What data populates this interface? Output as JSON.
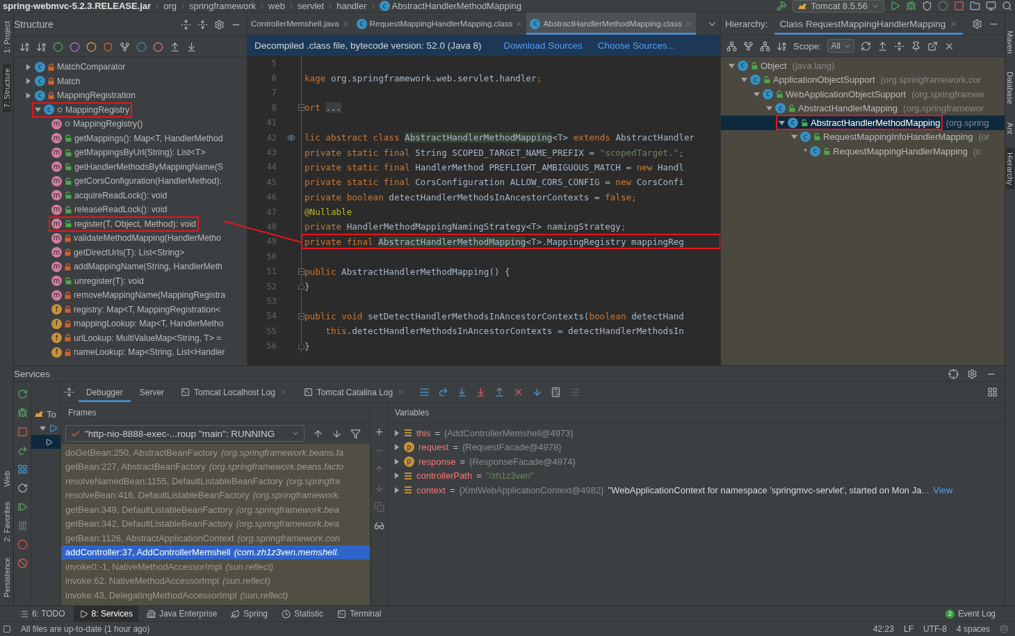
{
  "breadcrumbs": [
    {
      "label": "spring-webmvc-5.2.3.RELEASE.jar",
      "kind": "jar"
    },
    {
      "label": "org",
      "kind": "package"
    },
    {
      "label": "springframework",
      "kind": "package"
    },
    {
      "label": "web",
      "kind": "package"
    },
    {
      "label": "servlet",
      "kind": "package"
    },
    {
      "label": "handler",
      "kind": "package"
    },
    {
      "label": "AbstractHandlerMethodMapping",
      "kind": "class",
      "symbol": "c"
    }
  ],
  "run_config": {
    "label": "Tomcat 8.5.56"
  },
  "left_strip": [
    {
      "label": "1: Project",
      "selected": false
    },
    {
      "label": "7: Structure",
      "selected": true
    }
  ],
  "left_strip_bottom": [
    {
      "label": "Web",
      "selected": false
    },
    {
      "label": "2: Favorites",
      "selected": false
    },
    {
      "label": "Persistence",
      "selected": false
    }
  ],
  "right_strip": [
    {
      "label": "Maven",
      "selected": false
    },
    {
      "label": "Database",
      "selected": false
    },
    {
      "label": "Ant",
      "selected": false
    },
    {
      "label": "Hierarchy",
      "selected": true
    }
  ],
  "annotation_connector": true,
  "structure": {
    "title": "Structure",
    "items": [
      {
        "label": "MatchComparator",
        "kind": "class",
        "symbol": "c",
        "private": true,
        "public": false,
        "expanded": false,
        "annotated": false
      },
      {
        "label": "Match",
        "kind": "class",
        "symbol": "c",
        "private": true,
        "public": false,
        "expanded": false,
        "annotated": false
      },
      {
        "label": "MappingRegistration",
        "kind": "class",
        "symbol": "c",
        "private": true,
        "public": false,
        "expanded": false,
        "annotated": false
      },
      {
        "label": "MappingRegistry",
        "kind": "class",
        "symbol": "c",
        "private": false,
        "public": false,
        "expanded": true,
        "annotated": true,
        "children": [
          {
            "label": "MappingRegistry()",
            "kind": "method",
            "symbol": "m",
            "private": false,
            "public": false,
            "annotated": false
          },
          {
            "label": "getMappings(): Map<T, HandlerMethod",
            "kind": "method",
            "symbol": "m",
            "private": false,
            "public": true,
            "annotated": false
          },
          {
            "label": "getMappingsByUrl(String): List<T>",
            "kind": "method",
            "symbol": "m",
            "private": false,
            "public": true,
            "annotated": false
          },
          {
            "label": "getHandlerMethodsByMappingName(S",
            "kind": "method",
            "symbol": "m",
            "private": false,
            "public": true,
            "annotated": false
          },
          {
            "label": "getCorsConfiguration(HandlerMethod):",
            "kind": "method",
            "symbol": "m",
            "private": false,
            "public": true,
            "annotated": false
          },
          {
            "label": "acquireReadLock(): void",
            "kind": "method",
            "symbol": "m",
            "private": false,
            "public": true,
            "annotated": false
          },
          {
            "label": "releaseReadLock(): void",
            "kind": "method",
            "symbol": "m",
            "private": false,
            "public": true,
            "annotated": false
          },
          {
            "label": "register(T, Object, Method): void",
            "kind": "method",
            "symbol": "m",
            "private": false,
            "public": true,
            "annotated": true
          },
          {
            "label": "validateMethodMapping(HandlerMetho",
            "kind": "method",
            "symbol": "m",
            "private": true,
            "public": false,
            "annotated": false
          },
          {
            "label": "getDirectUrls(T): List<String>",
            "kind": "method",
            "symbol": "m",
            "private": true,
            "public": false,
            "annotated": false
          },
          {
            "label": "addMappingName(String, HandlerMeth",
            "kind": "method",
            "symbol": "m",
            "private": true,
            "public": false,
            "annotated": false
          },
          {
            "label": "unregister(T): void",
            "kind": "method",
            "symbol": "m",
            "private": false,
            "public": true,
            "annotated": false
          },
          {
            "label": "removeMappingName(MappingRegistra",
            "kind": "method",
            "symbol": "m",
            "private": true,
            "public": false,
            "annotated": false
          },
          {
            "label": "registry: Map<T, MappingRegistration<",
            "kind": "field",
            "symbol": "f",
            "private": true,
            "public": false,
            "annotated": false
          },
          {
            "label": "mappingLookup: Map<T, HandlerMetho",
            "kind": "field",
            "symbol": "f",
            "private": true,
            "public": false,
            "annotated": false
          },
          {
            "label": "urlLookup: MultiValueMap<String, T> =",
            "kind": "field",
            "symbol": "f",
            "private": true,
            "public": false,
            "annotated": false
          },
          {
            "label": "nameLookup: Map<String, List<Handler",
            "kind": "field",
            "symbol": "f",
            "private": true,
            "public": false,
            "annotated": false
          }
        ]
      }
    ]
  },
  "editor": {
    "tabs": [
      {
        "label": "ControllerMemshell.java",
        "kind": "java",
        "selected": false
      },
      {
        "label": "RequestMappingHandlerMapping.class",
        "kind": "class",
        "symbol": "c",
        "selected": false
      },
      {
        "label": "AbstractHandlerMethodMapping.class",
        "kind": "class",
        "symbol": "c",
        "selected": true
      }
    ],
    "banner": {
      "text": "Decompiled .class file, bytecode version: 52.0 (Java 8)",
      "links": [
        "Download Sources",
        "Choose Sources..."
      ]
    },
    "lines": [
      {
        "number": "5"
      },
      {
        "number": "6",
        "segments": [
          {
            "text": "kage",
            "kind": "keyword"
          },
          {
            "text": " org.springframework.web.servlet.handler",
            "kind": "plain"
          },
          {
            "text": ";",
            "kind": "keyword"
          }
        ]
      },
      {
        "number": "7"
      },
      {
        "number": "8",
        "kind": "fold_start",
        "segments": [
          {
            "text": "ort ",
            "kind": "keyword"
          },
          {
            "text": "...",
            "kind": "folded"
          }
        ]
      },
      {
        "number": "41"
      },
      {
        "number": "42",
        "gutter_icon": true,
        "segments": [
          {
            "text": "lic abstract class ",
            "kind": "keyword"
          },
          {
            "text": "AbstractHandlerMethodMapping",
            "kind": "reference"
          },
          {
            "text": "<T> ",
            "kind": "plain"
          },
          {
            "text": "extends ",
            "kind": "keyword"
          },
          {
            "text": "AbstractHandler",
            "kind": "plain"
          }
        ]
      },
      {
        "number": "43",
        "segments": [
          {
            "text": "private static final ",
            "kind": "keyword"
          },
          {
            "text": "String SCOPED_TARGET_NAME_PREFIX = ",
            "kind": "plain"
          },
          {
            "text": "\"scopedTarget.\"",
            "kind": "string"
          },
          {
            "text": ";",
            "kind": "keyword"
          }
        ]
      },
      {
        "number": "44",
        "segments": [
          {
            "text": "private static final ",
            "kind": "keyword"
          },
          {
            "text": "HandlerMethod PREFLIGHT_AMBIGUOUS_MATCH = ",
            "kind": "plain"
          },
          {
            "text": "new ",
            "kind": "keyword"
          },
          {
            "text": "Handl",
            "kind": "plain"
          }
        ]
      },
      {
        "number": "45",
        "segments": [
          {
            "text": "private static final ",
            "kind": "keyword"
          },
          {
            "text": "CorsConfiguration ALLOW_CORS_CONFIG = ",
            "kind": "plain"
          },
          {
            "text": "new ",
            "kind": "keyword"
          },
          {
            "text": "CorsConfi",
            "kind": "plain"
          }
        ]
      },
      {
        "number": "46",
        "segments": [
          {
            "text": "private boolean ",
            "kind": "keyword"
          },
          {
            "text": "detectHandlerMethodsInAncestorContexts = ",
            "kind": "plain"
          },
          {
            "text": "false;",
            "kind": "keyword"
          }
        ]
      },
      {
        "number": "47",
        "segments": [
          {
            "text": "@Nullable",
            "kind": "annotation"
          }
        ]
      },
      {
        "number": "48",
        "segments": [
          {
            "text": "private ",
            "kind": "keyword"
          },
          {
            "text": "HandlerMethodMappingNamingStrategy<T> namingStrategy",
            "kind": "plain"
          },
          {
            "text": ";",
            "kind": "keyword"
          }
        ]
      },
      {
        "number": "49",
        "annotated": true,
        "segments": [
          {
            "text": "private final ",
            "kind": "keyword"
          },
          {
            "text": "AbstractHandlerMethodMapping",
            "kind": "reference"
          },
          {
            "text": "<T>.MappingRegistry mappingReg",
            "kind": "plain"
          }
        ]
      },
      {
        "number": "50"
      },
      {
        "number": "51",
        "kind": "fold_start",
        "segments": [
          {
            "text": "public ",
            "kind": "keyword"
          },
          {
            "text": "AbstractHandlerMethodMapping() {",
            "kind": "plain"
          }
        ]
      },
      {
        "number": "52",
        "kind": "fold_end",
        "segments": [
          {
            "text": "}",
            "kind": "plain"
          }
        ]
      },
      {
        "number": "53"
      },
      {
        "number": "54",
        "kind": "fold_start",
        "segments": [
          {
            "text": "public void ",
            "kind": "keyword"
          },
          {
            "text": "setDetectHandlerMethodsInAncestorContexts(",
            "kind": "plain"
          },
          {
            "text": "boolean ",
            "kind": "keyword"
          },
          {
            "text": "detectHand",
            "kind": "plain"
          }
        ]
      },
      {
        "number": "55",
        "segments": [
          {
            "text": "    this",
            "kind": "keyword"
          },
          {
            "text": ".detectHandlerMethodsInAncestorContexts = detectHandlerMethodsIn",
            "kind": "plain"
          }
        ]
      },
      {
        "number": "56",
        "kind": "fold_end",
        "segments": [
          {
            "text": "}",
            "kind": "plain"
          }
        ]
      }
    ]
  },
  "hierarchy": {
    "label": "Hierarchy:",
    "tab": "Class RequestMappingHandlerMapping",
    "scope_label": "Scope:",
    "scope": "All",
    "items": [
      {
        "name": "Object",
        "symbol": "c",
        "package": "(java.lang)",
        "expanded": true,
        "selected": false,
        "annotated": false,
        "children": [
          {
            "name": "ApplicationObjectSupport",
            "symbol": "c",
            "package": "(org.springframework.cor",
            "expanded": true,
            "selected": false,
            "annotated": false,
            "children": [
              {
                "name": "WebApplicationObjectSupport",
                "symbol": "c",
                "package": "(org.springframew",
                "expanded": true,
                "selected": false,
                "annotated": false,
                "children": [
                  {
                    "name": "AbstractHandlerMapping",
                    "symbol": "c",
                    "package": "(org.springframewor",
                    "expanded": true,
                    "selected": false,
                    "annotated": false,
                    "children": [
                      {
                        "name": "AbstractHandlerMethodMapping",
                        "symbol": "c",
                        "package": "(org.spring",
                        "expanded": true,
                        "selected": true,
                        "annotated": true,
                        "children": [
                          {
                            "name": "RequestMappingInfoHandlerMapping",
                            "symbol": "c",
                            "package": "(or",
                            "expanded": true,
                            "selected": false,
                            "annotated": false,
                            "children": [
                              {
                                "name": "RequestMappingHandlerMapping",
                                "symbol": "c",
                                "package": "(c",
                                "marker": "*",
                                "selected": false,
                                "annotated": false
                              }
                            ]
                          }
                        ]
                      }
                    ]
                  }
                ]
              }
            ]
          }
        ]
      }
    ]
  },
  "services": {
    "title": "Services",
    "tree": [
      {
        "kind": "server",
        "label": "To",
        "selected": false
      },
      {
        "kind": "deployment",
        "expanded": true,
        "selected": false
      },
      {
        "kind": "debug_session",
        "selected": true
      }
    ],
    "tabs": [
      {
        "label": "Debugger",
        "kind": "plain",
        "selected": true
      },
      {
        "label": "Server",
        "kind": "plain",
        "selected": false
      },
      {
        "label": "Tomcat Localhost Log",
        "kind": "log",
        "selected": false
      },
      {
        "label": "Tomcat Catalina Log",
        "kind": "log",
        "selected": false
      }
    ],
    "frames_title": "Frames",
    "thread": "\"http-nio-8888-exec-...roup \"main\": RUNNING",
    "frames": [
      {
        "method": "doGetBean:250, AbstractBeanFactory",
        "location": "(org.springframework.beans.fa",
        "selected": false
      },
      {
        "method": "getBean:227, AbstractBeanFactory",
        "location": "(org.springframework.beans.facto",
        "selected": false
      },
      {
        "method": "resolveNamedBean:1155, DefaultListableBeanFactory",
        "location": "(org.springfra",
        "selected": false
      },
      {
        "method": "resolveBean:416, DefaultListableBeanFactory",
        "location": "(org.springframework.",
        "selected": false
      },
      {
        "method": "getBean:349, DefaultListableBeanFactory",
        "location": "(org.springframework.bea",
        "selected": false
      },
      {
        "method": "getBean:342, DefaultListableBeanFactory",
        "location": "(org.springframework.bea",
        "selected": false
      },
      {
        "method": "getBean:1126, AbstractApplicationContext",
        "location": "(org.springframework.con",
        "selected": false
      },
      {
        "method": "addController:37, AddControllerMemshell",
        "location": "(com.zh1z3ven.memshell.",
        "selected": true
      },
      {
        "method": "invoke0:-1, NativeMethodAccessorImpl",
        "location": "(sun.reflect)",
        "selected": false
      },
      {
        "method": "invoke:62, NativeMethodAccessorImpl",
        "location": "(sun.reflect)",
        "selected": false
      },
      {
        "method": "invoke:43, DelegatingMethodAccessorImpl",
        "location": "(sun.reflect)",
        "selected": false
      }
    ],
    "variables_title": "Variables",
    "variables": [
      {
        "name": "this",
        "kind": "field",
        "operator": "=",
        "value": "{AddControllerMemshell@4973}",
        "string": false
      },
      {
        "name": "request",
        "kind": "param",
        "symbol": "p",
        "operator": "=",
        "value": "{RequestFacade@4978}",
        "string": false
      },
      {
        "name": "response",
        "kind": "param",
        "symbol": "p",
        "operator": "=",
        "value": "{ResponseFacade@4974}",
        "string": false
      },
      {
        "name": "controllerPath",
        "kind": "field",
        "operator": "=",
        "value": "\"/zh1z3ven\"",
        "string": true
      },
      {
        "name": "context",
        "kind": "field",
        "operator": "=",
        "value": "{XmlWebApplicationContext@4982}",
        "string": false,
        "description": "\"WebApplicationContext for namespace 'springmvc-servlet', started on Mon Ja",
        "more": "...",
        "link": "View"
      }
    ]
  },
  "tool_tabs": [
    {
      "label": "6: TODO",
      "kind": "todo",
      "selected": false
    },
    {
      "label": "8: Services",
      "kind": "services",
      "selected": true
    },
    {
      "label": "Java Enterprise",
      "kind": "enterprise",
      "selected": false
    },
    {
      "label": "Spring",
      "kind": "spring",
      "selected": false
    },
    {
      "label": "Statistic",
      "kind": "statistic",
      "selected": false
    },
    {
      "label": "Terminal",
      "kind": "terminal",
      "selected": false
    }
  ],
  "event_log": {
    "count": "2",
    "label": "Event Log"
  },
  "status_bar": {
    "message": "All files are up-to-date (1 hour ago)",
    "items": [
      "42:23",
      "LF",
      "UTF-8",
      "4 spaces"
    ]
  }
}
